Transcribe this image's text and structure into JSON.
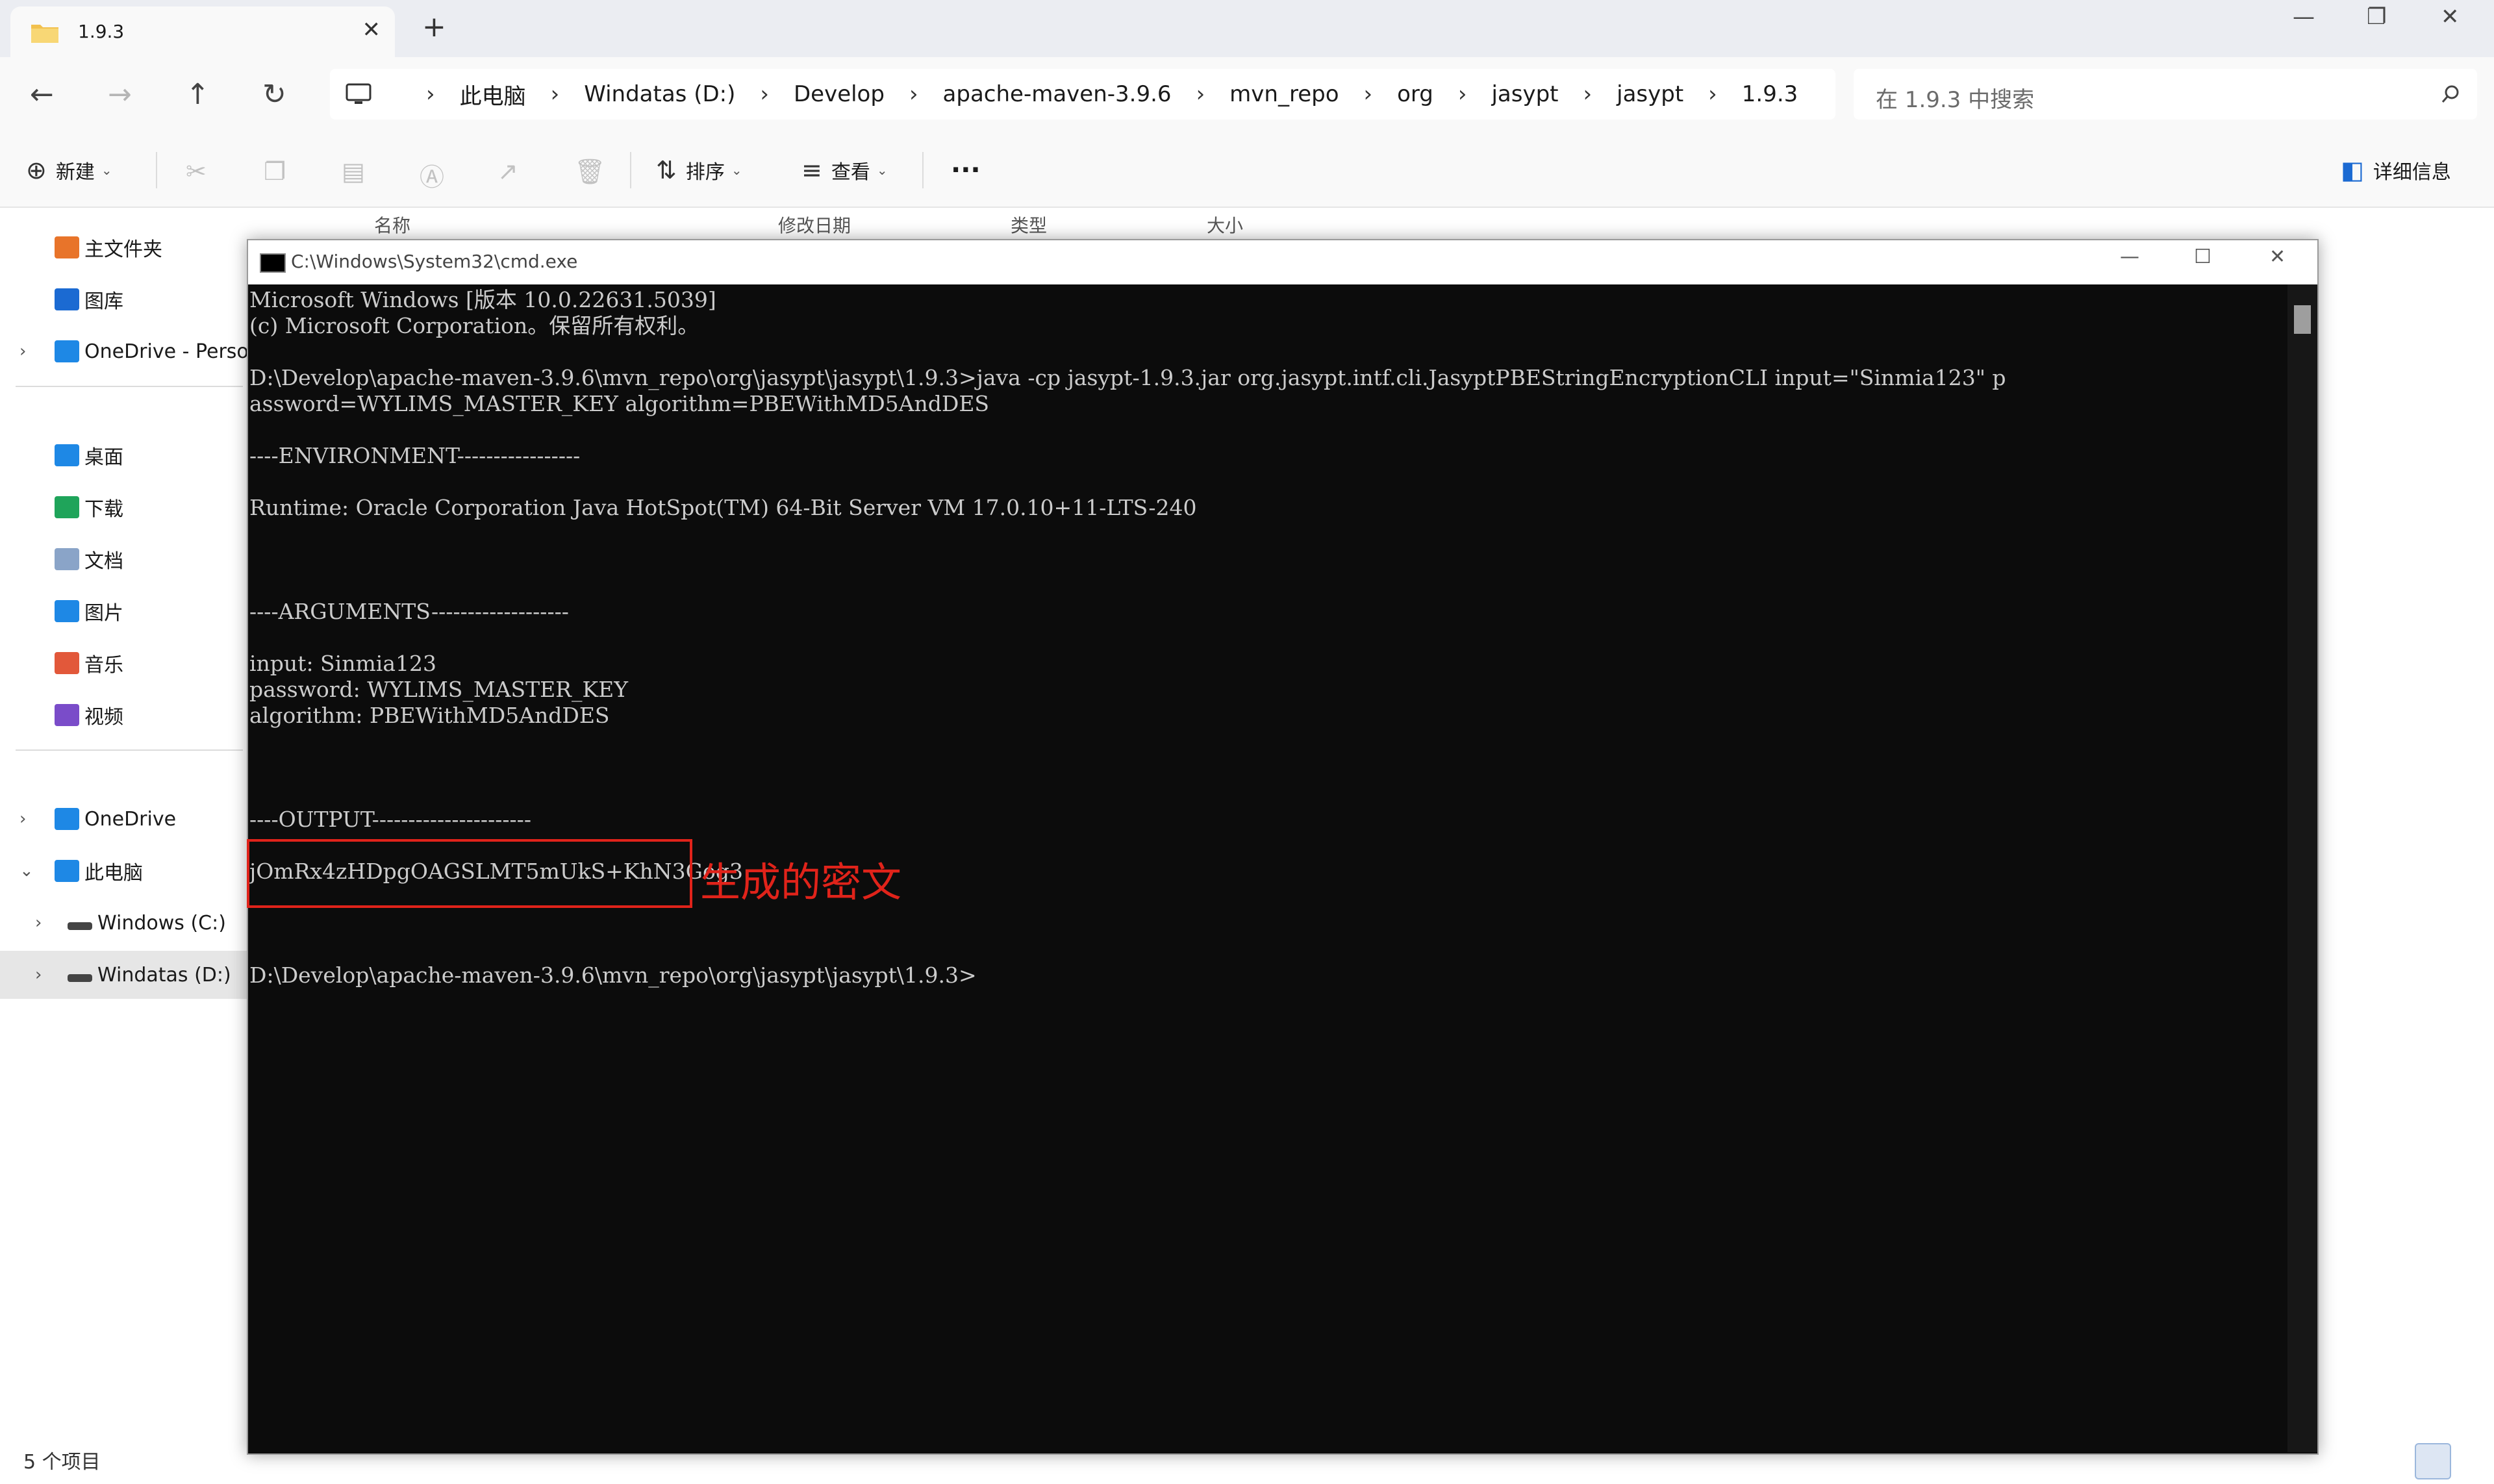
{
  "tab": {
    "title": "1.9.3"
  },
  "window_controls": {
    "minimize": "—",
    "restore": "❐",
    "close": "✕"
  },
  "nav_buttons": {
    "back": "←",
    "forward": "→",
    "up": "↑",
    "refresh": "↻"
  },
  "breadcrumb": [
    "此电脑",
    "Windatas (D:)",
    "Develop",
    "apache-maven-3.9.6",
    "mvn_repo",
    "org",
    "jasypt",
    "jasypt",
    "1.9.3"
  ],
  "breadcrumb_separator": "›",
  "search": {
    "placeholder": "在 1.9.3 中搜索"
  },
  "toolbar": {
    "new_label": "新建",
    "sort_label": "排序",
    "view_label": "查看",
    "more_label": "···",
    "details_label": "详细信息"
  },
  "columns": {
    "name": "名称",
    "modified": "修改日期",
    "type": "类型",
    "size": "大小"
  },
  "sidebar": {
    "items": [
      {
        "label": "主文件夹",
        "icon": "home-icon",
        "color": "#e8742a"
      },
      {
        "label": "图库",
        "icon": "gallery-icon",
        "color": "#1b6ad2"
      },
      {
        "label": "OneDrive - Personal",
        "icon": "onedrive-folder-icon",
        "color": "#1e88e5"
      },
      {
        "label": "桌面",
        "icon": "desktop-folder-icon",
        "color": "#1e88e5"
      },
      {
        "label": "下载",
        "icon": "downloads-folder-icon",
        "color": "#1fa45a"
      },
      {
        "label": "文档",
        "icon": "documents-folder-icon",
        "color": "#8aa4c8"
      },
      {
        "label": "图片",
        "icon": "pictures-folder-icon",
        "color": "#1e88e5"
      },
      {
        "label": "音乐",
        "icon": "music-folder-icon",
        "color": "#e2583a"
      },
      {
        "label": "视频",
        "icon": "videos-folder-icon",
        "color": "#7a4cc9"
      },
      {
        "label": "OneDrive",
        "icon": "onedrive-folder-icon",
        "color": "#1e88e5"
      },
      {
        "label": "此电脑",
        "icon": "pc-icon",
        "color": "#1e88e5"
      },
      {
        "label": "Windows (C:)",
        "icon": "drive-icon",
        "color": "#444444"
      },
      {
        "label": "Windatas (D:)",
        "icon": "drive-icon",
        "color": "#444444"
      }
    ]
  },
  "status": {
    "item_count": "5 个项目"
  },
  "cmd": {
    "title": "C:\\Windows\\System32\\cmd.exe",
    "lines": [
      "Microsoft Windows [版本 10.0.22631.5039]",
      "(c) Microsoft Corporation。保留所有权利。",
      "",
      "D:\\Develop\\apache-maven-3.9.6\\mvn_repo\\org\\jasypt\\jasypt\\1.9.3>java -cp jasypt-1.9.3.jar org.jasypt.intf.cli.JasyptPBEStringEncryptionCLI input=\"Sinmia123\" p",
      "assword=WYLIMS_MASTER_KEY algorithm=PBEWithMD5AndDES",
      "",
      "----ENVIRONMENT-----------------",
      "",
      "Runtime: Oracle Corporation Java HotSpot(TM) 64-Bit Server VM 17.0.10+11-LTS-240",
      "",
      "",
      "",
      "----ARGUMENTS-------------------",
      "",
      "input: Sinmia123",
      "password: WYLIMS_MASTER_KEY",
      "algorithm: PBEWithMD5AndDES",
      "",
      "",
      "",
      "----OUTPUT----------------------",
      "",
      "jOmRx4zHDpgOAGSLMT5mUkS+KhN3Gog3",
      "",
      "",
      "",
      "D:\\Develop\\apache-maven-3.9.6\\mvn_repo\\org\\jasypt\\jasypt\\1.9.3>"
    ]
  },
  "annotation": {
    "label": "生成的密文",
    "color": "#e0231a"
  }
}
